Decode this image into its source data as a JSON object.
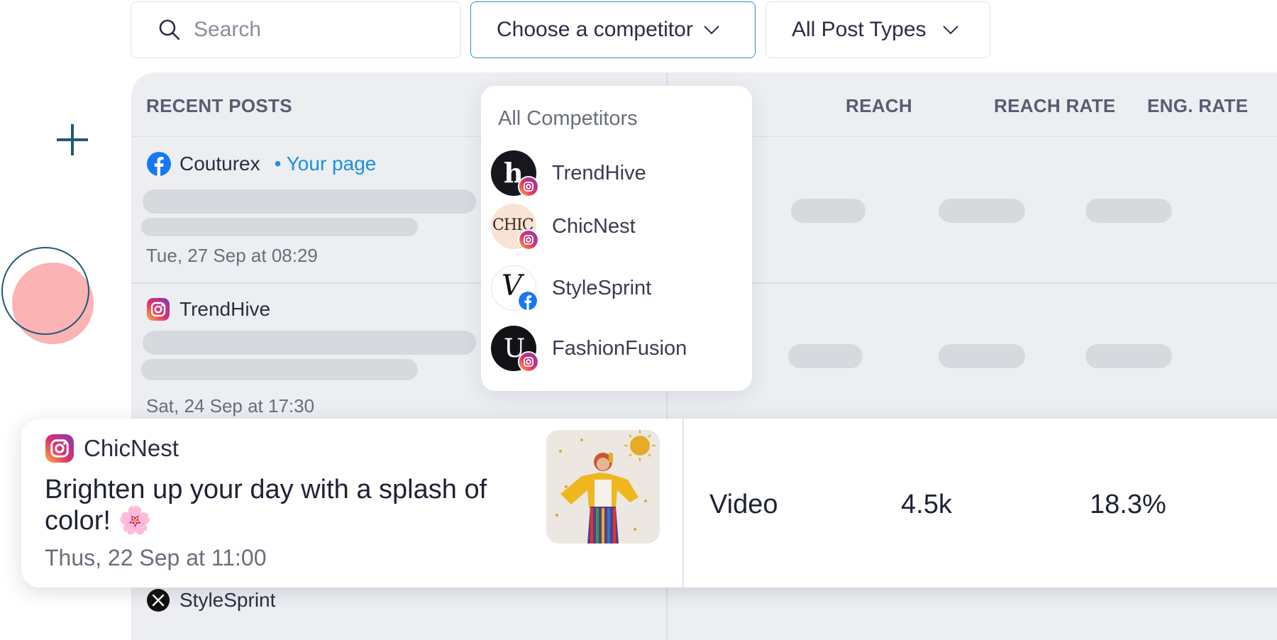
{
  "toolbar": {
    "search_placeholder": "Search",
    "competitor_label": "Choose a competitor",
    "post_types_label": "All Post Types"
  },
  "table": {
    "headers": {
      "recent_posts": "RECENT POSTS",
      "reach": "REACH",
      "reach_rate": "REACH RATE",
      "eng_rate": "ENG. RATE"
    },
    "rows": [
      {
        "name": "Couturex",
        "tag": "• Your page",
        "date": "Tue, 27 Sep at 08:29",
        "network": "facebook"
      },
      {
        "name": "TrendHive",
        "date": "Sat, 24 Sep at 17:30",
        "network": "instagram"
      },
      {
        "name": "StyleSprint",
        "network": "x"
      }
    ]
  },
  "dropdown": {
    "title": "All Competitors",
    "items": [
      {
        "name": "TrendHive",
        "network": "instagram",
        "avatar_text": "h"
      },
      {
        "name": "ChicNest",
        "network": "instagram",
        "avatar_text": "CHIC"
      },
      {
        "name": "StyleSprint",
        "network": "facebook",
        "avatar_text": "V"
      },
      {
        "name": "FashionFusion",
        "network": "instagram",
        "avatar_text": "U"
      }
    ]
  },
  "highlight": {
    "name": "ChicNest",
    "network": "instagram",
    "text": "Brighten up your day with a splash of color! 🌸",
    "date": "Thus, 22 Sep at 11:00",
    "type": "Video",
    "reach": "4.5k",
    "reach_rate": "18.3%"
  },
  "colors": {
    "accent_blue": "#2f8fcb",
    "facebook": "#1877f2",
    "instagram_gradient": [
      "#feda75",
      "#fa7e1e",
      "#d62976",
      "#962fbf"
    ],
    "table_bg": "#eceef2",
    "skeleton": "#d7d9df",
    "deco_pink": "#fbb3b4",
    "deco_teal": "#1e5b72"
  }
}
